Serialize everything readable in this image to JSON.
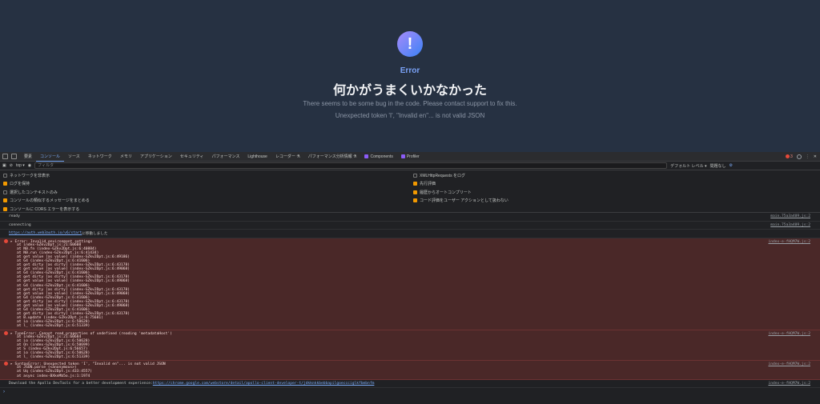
{
  "page": {
    "label": "Error",
    "title": "何かがうまくいかなかった",
    "description": "There seems to be some bug in the code. Please contact support to fix this.",
    "detail": "Unexpected token 'I', \"Invalid en\"... is not valid JSON",
    "icon": "exclamation-icon"
  },
  "devtools": {
    "tabs": [
      "要素",
      "コンソール",
      "ソース",
      "ネットワーク",
      "メモリ",
      "アプリケーション",
      "セキュリティ",
      "パフォーマンス",
      "Lighthouse",
      "レコーダー ⚗",
      "パフォーマンス分析情報 ⚗",
      "Components",
      "Profiler"
    ],
    "active_tab": "コンソール",
    "error_count": "3",
    "context": "top",
    "filter_placeholder": "フィルタ",
    "level": "デフォルト レベル ▾",
    "issues": "問題なし",
    "settings_left": [
      {
        "label": "ネットワークを非表示",
        "checked": false
      },
      {
        "label": "ログを保持",
        "checked": true
      },
      {
        "label": "選択したコンテキストのみ",
        "checked": false
      },
      {
        "label": "コンソールの類似するメッセージをまとめる",
        "checked": true
      },
      {
        "label": "コンソールに CORS エラーを表示する",
        "checked": true
      }
    ],
    "settings_right": [
      {
        "label": "XMLHttpRequests をログ",
        "checked": false
      },
      {
        "label": "先行評価",
        "checked": true
      },
      {
        "label": "履歴からオートコンプリート",
        "checked": true
      },
      {
        "label": "コード評価をユーザー アクションとして扱わない",
        "checked": true
      }
    ],
    "logs": [
      {
        "text": "ready",
        "source": "main.75a3a409.js:2"
      },
      {
        "text": "connecting",
        "source": "main.75a3a409.js:2"
      },
      {
        "link": "https://auth.web3auth.io/v6/start",
        "text": " に移動しました"
      }
    ],
    "errors": [
      {
        "message": "▸ Error: Invalid environment settings",
        "source": "index-e-fHQM7W.js:2",
        "frames": [
          "at index-GZkv2Dpt.js:21:60608",
          "at N0.fn (index-GZkv2Dpt.js:6:40884)",
          "at N0.run (index-GZkv2Dpt.js:6:41434)",
          "at get value [as value] (index-GZkv2Dpt.js:6:49186)",
          "at G4 (index-GZkv2Dpt.js:6:41606)",
          "at get dirty [as dirty] (index-GZkv2Dpt.js:6:43178)",
          "at get value [as value] (index-GZkv2Dpt.js:6:49068)",
          "at G4 (index-GZkv2Dpt.js:6:41606)",
          "at get dirty [as dirty] (index-GZkv2Dpt.js:6:43178)",
          "at get value [as value] (index-GZkv2Dpt.js:6:49068)",
          "at G4 (index-GZkv2Dpt.js:6:41606)",
          "at get dirty [as dirty] (index-GZkv2Dpt.js:6:43178)",
          "at get value [as value] (index-GZkv2Dpt.js:6:49068)",
          "at G4 (index-GZkv2Dpt.js:6:41606)",
          "at get dirty [as dirty] (index-GZkv2Dpt.js:6:43178)",
          "at get value [as value] (index-GZkv2Dpt.js:6:49068)",
          "at G4 (index-GZkv2Dpt.js:6:41606)",
          "at get dirty [as dirty] (index-GZkv2Dpt.js:6:43178)",
          "at B.update (index-GZkv2Dpt.js:6:75681)",
          "at io (index-GZkv2Dpt.js:6:50628)",
          "at l_ (index-GZkv2Dpt.js:6:51339)"
        ]
      },
      {
        "message": "▸ TypeError: Cannot read properties of undefined (reading 'metadataHost')",
        "source": "index-e-fHQM7W.js:2",
        "frames": [
          "at index-GZkv2Dpt.js:21:60684",
          "at io (index-GZkv2Dpt.js:6:50628)",
          "at On (index-GZkv2Dpt.js:6:50699)",
          "at S (index-GZkv2Dpt.js:6:56657)",
          "at io (index-GZkv2Dpt.js:6:50628)",
          "at l_ (index-GZkv2Dpt.js:6:51339)"
        ]
      },
      {
        "message": "▸ SyntaxError: Unexpected token 'I', \"Invalid en\"... is not valid JSON",
        "source": "index-e-fHQM7W.js:2",
        "frames": [
          "at JSON.parse (<anonymous>)",
          "at Uq (index-GZkv2Dpt.js:433:4557)",
          "at async index-BXknMb5o.js:1:1974"
        ]
      }
    ],
    "apollo": {
      "text": "Download the Apollo DevTools for a better development experience: ",
      "link": "https://chrome.google.com/webstore/detail/apollo-client-developer-t/jdkknkkbebbapilgoeccciglkfbmbnfm",
      "source": "index-e-fHQM7W.js:2"
    },
    "prompt": "›"
  }
}
